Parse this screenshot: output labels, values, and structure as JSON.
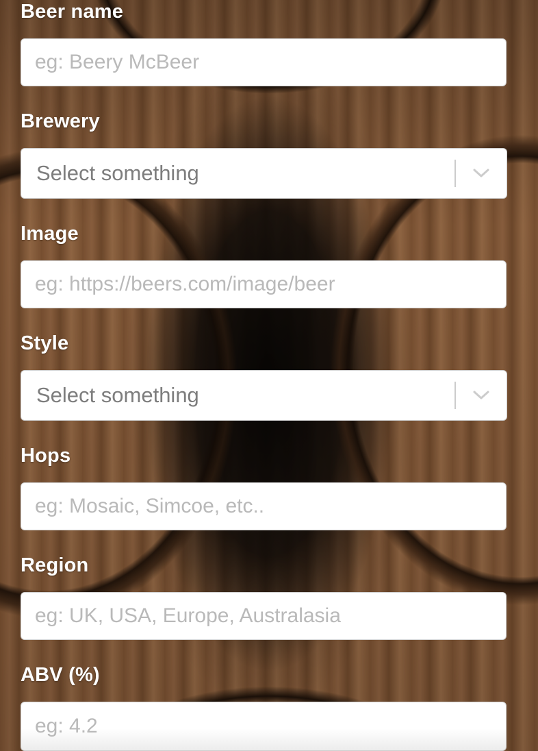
{
  "form": {
    "beer_name": {
      "label": "Beer name",
      "placeholder": "eg: Beery McBeer",
      "value": ""
    },
    "brewery": {
      "label": "Brewery",
      "selected": "Select something"
    },
    "image": {
      "label": "Image",
      "placeholder": "eg: https://beers.com/image/beer",
      "value": ""
    },
    "style": {
      "label": "Style",
      "selected": "Select something"
    },
    "hops": {
      "label": "Hops",
      "placeholder": "eg: Mosaic, Simcoe, etc..",
      "value": ""
    },
    "region": {
      "label": "Region",
      "placeholder": "eg: UK, USA, Europe, Australasia",
      "value": ""
    },
    "abv": {
      "label": "ABV (%)",
      "placeholder": "eg: 4.2",
      "value": ""
    }
  },
  "icons": {
    "dropdown": "chevron-down-icon"
  },
  "colors": {
    "label_text": "#ffffff",
    "placeholder_text": "#b9b9b9",
    "select_text": "#7d7d7d",
    "input_border": "#cccccc"
  }
}
